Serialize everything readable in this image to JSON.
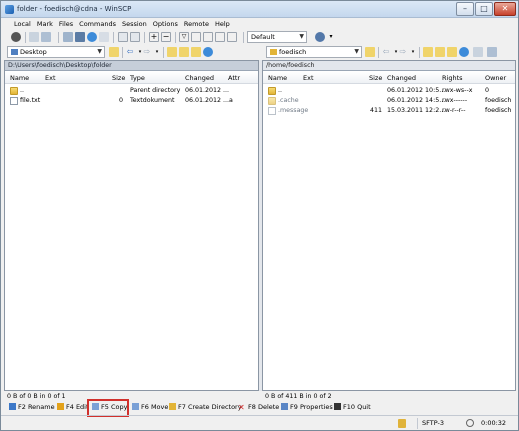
{
  "window": {
    "title": "folder - foedisch@cdna - WinSCP"
  },
  "menu": [
    "Local",
    "Mark",
    "Files",
    "Commands",
    "Session",
    "Options",
    "Remote",
    "Help"
  ],
  "toolbar": {
    "profile_value": "Default"
  },
  "left_panel": {
    "drive": "Desktop",
    "path": "D:\\Users\\foedisch\\Desktop\\folder",
    "columns": [
      "Name",
      "Ext",
      "Size",
      "Type",
      "Changed",
      "Attr"
    ],
    "rows": [
      {
        "name": "..",
        "size": "",
        "type": "Parent directory",
        "changed": "06.01.2012 ...",
        "attr": "",
        "kind": "folder"
      },
      {
        "name": "file.txt",
        "size": "0",
        "type": "Textdokument",
        "changed": "06.01.2012 ...",
        "attr": "a",
        "kind": "file"
      }
    ],
    "status": "0 B of 0 B in 0 of 1"
  },
  "right_panel": {
    "drive": "foedisch",
    "path": "/home/foedisch",
    "columns": [
      "Name",
      "Ext",
      "Size",
      "Changed",
      "Rights",
      "Owner"
    ],
    "rows": [
      {
        "name": "..",
        "size": "",
        "changed": "06.01.2012 10:5...",
        "rights": "rwx-ws--x",
        "owner": "0",
        "kind": "folder",
        "dim": false
      },
      {
        "name": ".cache",
        "size": "",
        "changed": "06.01.2012 14:5...",
        "rights": "rwx------",
        "owner": "foedisch",
        "kind": "folder",
        "dim": true
      },
      {
        "name": ".message",
        "size": "411",
        "changed": "15.03.2011 12:2...",
        "rights": "rw-r--r--",
        "owner": "foedisch",
        "kind": "file",
        "dim": true
      }
    ],
    "status": "0 B of 411 B in 0 of 2"
  },
  "fkeys": [
    {
      "label": "F2 Rename",
      "color": "#3c78c8"
    },
    {
      "label": "F4 Edit",
      "color": "#e3a21a"
    },
    {
      "label": "F5 Copy",
      "color": "#7aa0d6"
    },
    {
      "label": "F6 Move",
      "color": "#7aa0d6"
    },
    {
      "label": "F7 Create Directory",
      "color": "#e2b437"
    },
    {
      "label": "F8 Delete",
      "color": "#d12a2a"
    },
    {
      "label": "F9 Properties",
      "color": "#5a86c5"
    },
    {
      "label": "F10 Quit",
      "color": "#333333"
    }
  ],
  "statusbar": {
    "protocol": "SFTP-3",
    "timer": "0:00:32"
  }
}
